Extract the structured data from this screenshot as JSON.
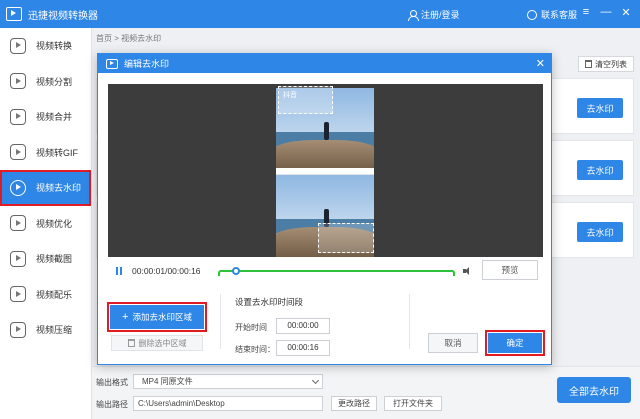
{
  "app": {
    "title": "迅捷视频转换器",
    "login": "注册/登录",
    "support": "联系客服"
  },
  "window_controls": [
    "≡",
    "—",
    "✕"
  ],
  "sidebar": {
    "items": [
      {
        "label": "视频转换",
        "icon": "video-convert-icon"
      },
      {
        "label": "视频分割",
        "icon": "scissors-icon"
      },
      {
        "label": "视频合并",
        "icon": "merge-icon"
      },
      {
        "label": "视频转GIF",
        "icon": "gif-icon"
      },
      {
        "label": "视频去水印",
        "icon": "watermark-remove-icon",
        "active": true
      },
      {
        "label": "视频优化",
        "icon": "optimize-icon"
      },
      {
        "label": "视频截图",
        "icon": "screenshot-icon"
      },
      {
        "label": "视频配乐",
        "icon": "music-icon"
      },
      {
        "label": "视频压缩",
        "icon": "compress-icon"
      }
    ]
  },
  "breadcrumb": "首页 > 视频去水印",
  "list": {
    "clear_label": "清空列表",
    "row_button_label": "去水印",
    "rows": 3
  },
  "bottom": {
    "format_label": "输出格式",
    "format_value": "MP4   同原文件",
    "path_label": "输出路径",
    "path_value": "C:\\Users\\admin\\Desktop",
    "change_path": "更改路径",
    "open_folder": "打开文件夹",
    "remove_all": "全部去水印"
  },
  "dialog": {
    "title": "编辑去水印",
    "close": "✕",
    "watermark_text": "抖音",
    "player": {
      "time": "00:00:01/00:00:16",
      "progress_fraction": 0.07,
      "preview": "预览"
    },
    "add_region": "添加去水印区域",
    "delete_region": "删除选中区域",
    "time_section_title": "设置去水印时间段",
    "start_label": "开始时间",
    "start_value": "00:00:00",
    "end_label": "结束时间：",
    "end_value": "00:00:16",
    "cancel": "取消",
    "confirm": "确定"
  },
  "colors": {
    "accent": "#2e86e6",
    "highlight": "#e01b24",
    "timeline": "#2ec13a"
  }
}
